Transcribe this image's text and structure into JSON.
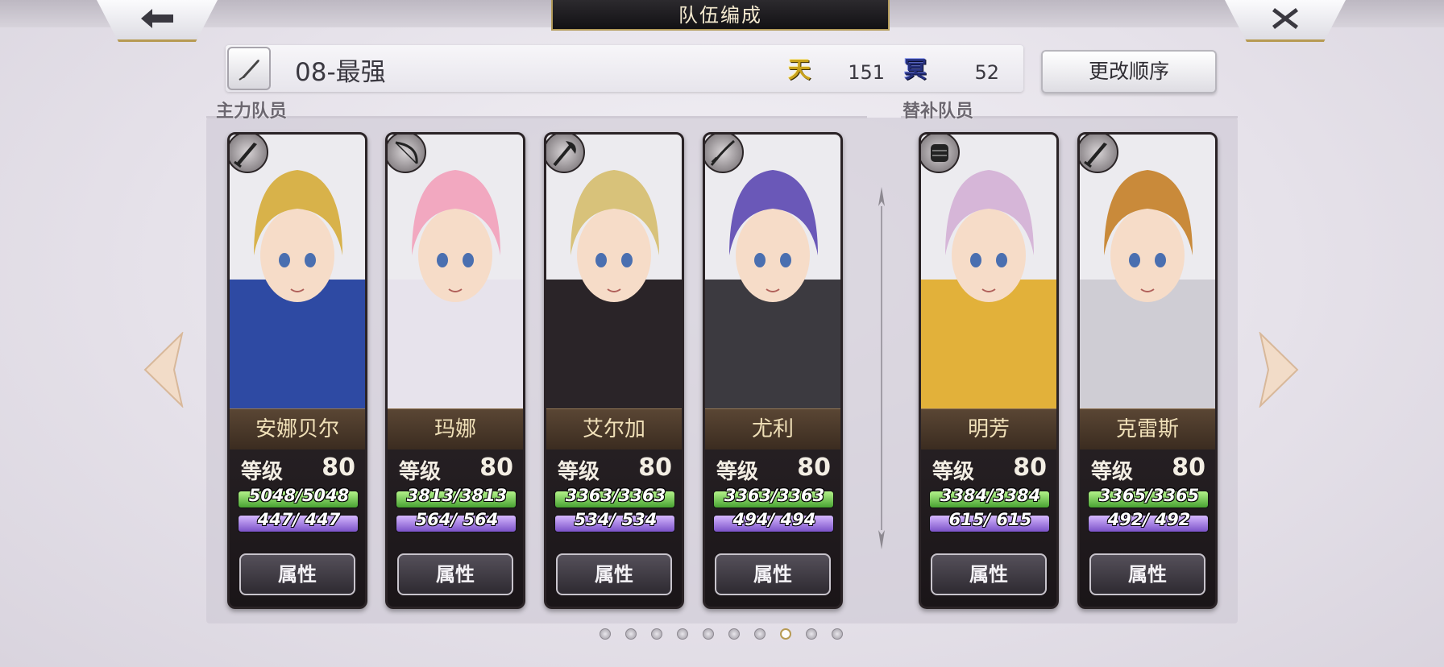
{
  "header": {
    "title": "队伍编成"
  },
  "team": {
    "name": "08-最强",
    "resources": [
      {
        "icon": "heaven-icon",
        "glyph": "天",
        "value": "151"
      },
      {
        "icon": "underworld-icon",
        "glyph": "冥",
        "value": "52"
      }
    ],
    "order_button": "更改顺序"
  },
  "sections": {
    "main": "主力队员",
    "sub": "替补队员"
  },
  "attr_label": "属性",
  "level_label": "等级",
  "characters": [
    {
      "name": "安娜贝尔",
      "weapon": "sword-icon",
      "level": "80",
      "hp": "5048/5048",
      "mp": "447/ 447",
      "hair": "#d8b24a",
      "outfit": "#2e4aa3"
    },
    {
      "name": "玛娜",
      "weapon": "bow-icon",
      "level": "80",
      "hp": "3813/3813",
      "mp": "564/ 564",
      "hair": "#f2a8c0",
      "outfit": "#e7e3ec"
    },
    {
      "name": "艾尔加",
      "weapon": "axe-icon",
      "level": "80",
      "hp": "3363/3363",
      "mp": "534/ 534",
      "hair": "#d8c27a",
      "outfit": "#2a2428"
    },
    {
      "name": "尤利",
      "weapon": "katana-icon",
      "level": "80",
      "hp": "3363/3363",
      "mp": "494/ 494",
      "hair": "#6a58b8",
      "outfit": "#3c3a40"
    },
    {
      "name": "明芳",
      "weapon": "fist-icon",
      "level": "80",
      "hp": "3384/3384",
      "mp": "615/ 615",
      "hair": "#d6b6d8",
      "outfit": "#e2b13a"
    },
    {
      "name": "克雷斯",
      "weapon": "sword-icon",
      "level": "80",
      "hp": "3365/3365",
      "mp": "492/ 492",
      "hair": "#c98a3a",
      "outfit": "#cfcdd4"
    }
  ],
  "pagination": {
    "total": 10,
    "current": 8
  }
}
